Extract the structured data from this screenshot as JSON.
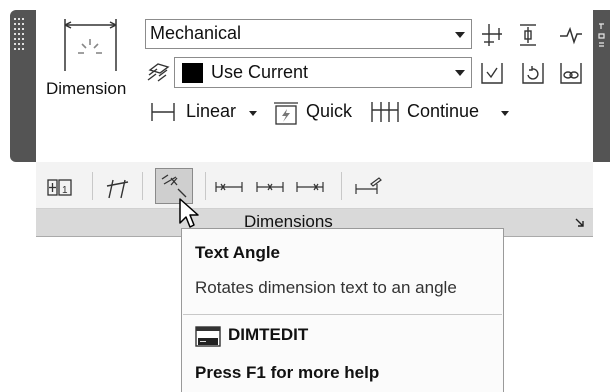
{
  "ribbon": {
    "dimension_label": "Dimension",
    "dim_style_value": "Mechanical",
    "layer_value": "Use Current",
    "layer_color": "#000000",
    "tools": [
      {
        "label": "Linear",
        "icon": "linear-dimension-icon",
        "has_dropdown": true
      },
      {
        "label": "Quick",
        "icon": "quick-dimension-icon",
        "has_dropdown": false
      },
      {
        "label": "Continue",
        "icon": "continue-dimension-icon",
        "has_dropdown": true
      }
    ],
    "upper_right_icons": [
      "dim-break-icon",
      "adjust-space-icon",
      "jogged-linear-icon",
      "inspect-icon",
      "update-icon",
      "reassociate-icon"
    ],
    "strip_icons": [
      "center-mark-icon",
      "oblique-icon",
      "text-angle-icon",
      "left-justify-icon",
      "center-justify-icon",
      "right-justify-icon",
      "override-icon"
    ],
    "panel_title": "Dimensions",
    "panel_launcher_icon": "panel-launcher-icon"
  },
  "tooltip": {
    "title": "Text Angle",
    "description": "Rotates dimension text to an angle",
    "command": "DIMTEDIT",
    "command_icon": "command-line-icon",
    "help": "Press F1 for more help"
  },
  "colors": {
    "frame": "#545454",
    "panel_bg": "#ffffff",
    "strip_bg": "#f3f3f3",
    "titlebar_bg": "#d9d9d9",
    "pressed_button": "#cfcfcf"
  }
}
